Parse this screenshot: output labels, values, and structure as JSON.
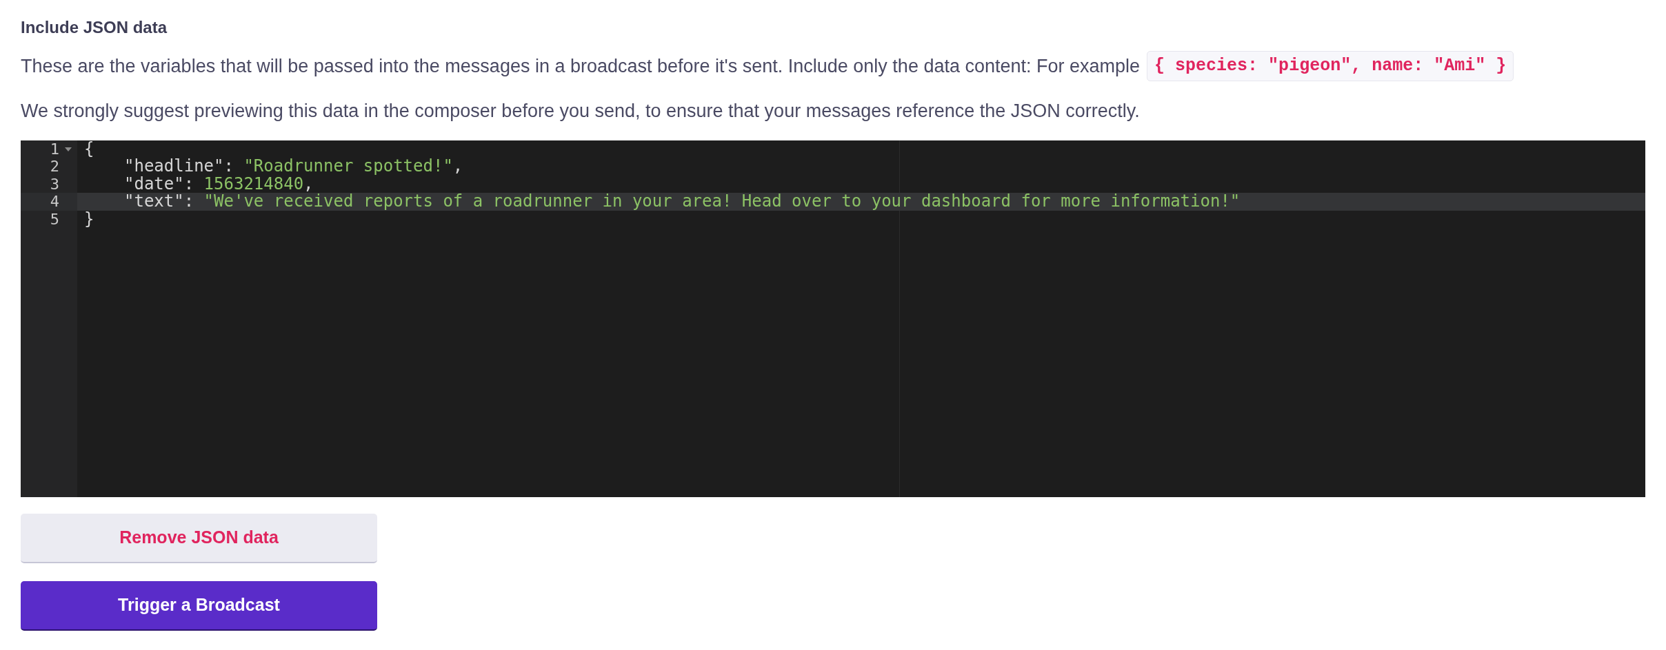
{
  "heading": "Include JSON data",
  "description": [
    {
      "text": "These are the variables that will be passed into the messages in a broadcast before it's sent. Include only the data content: For example",
      "code": "{ species: \"pigeon\", name: \"Ami\" }"
    },
    {
      "text": "We strongly suggest previewing this data in the composer before you send, to ensure that your messages reference the JSON correctly."
    }
  ],
  "editor": {
    "lines": [
      {
        "number": "1",
        "foldable": true,
        "active": false,
        "tokens": [
          {
            "kind": "punct",
            "text": "{"
          }
        ]
      },
      {
        "number": "2",
        "foldable": false,
        "active": false,
        "tokens": [
          {
            "kind": "key",
            "text": "\"headline\": "
          },
          {
            "kind": "string",
            "text": "\"Roadrunner spotted!\""
          },
          {
            "kind": "punct",
            "text": ","
          }
        ]
      },
      {
        "number": "3",
        "foldable": false,
        "active": false,
        "tokens": [
          {
            "kind": "key",
            "text": "\"date\": "
          },
          {
            "kind": "number",
            "text": "1563214840"
          },
          {
            "kind": "punct",
            "text": ","
          }
        ]
      },
      {
        "number": "4",
        "foldable": false,
        "active": true,
        "tokens": [
          {
            "kind": "key",
            "text": "\"text\": "
          },
          {
            "kind": "string",
            "text": "\"We've received reports of a roadrunner in your area! Head over to your dashboard for more information!\""
          }
        ]
      },
      {
        "number": "5",
        "foldable": false,
        "active": false,
        "tokens": [
          {
            "kind": "punct",
            "text": "}"
          }
        ]
      }
    ]
  },
  "buttons": [
    {
      "kind": "secondary",
      "label": "Remove JSON data"
    },
    {
      "kind": "primary",
      "label": "Trigger a Broadcast"
    }
  ]
}
